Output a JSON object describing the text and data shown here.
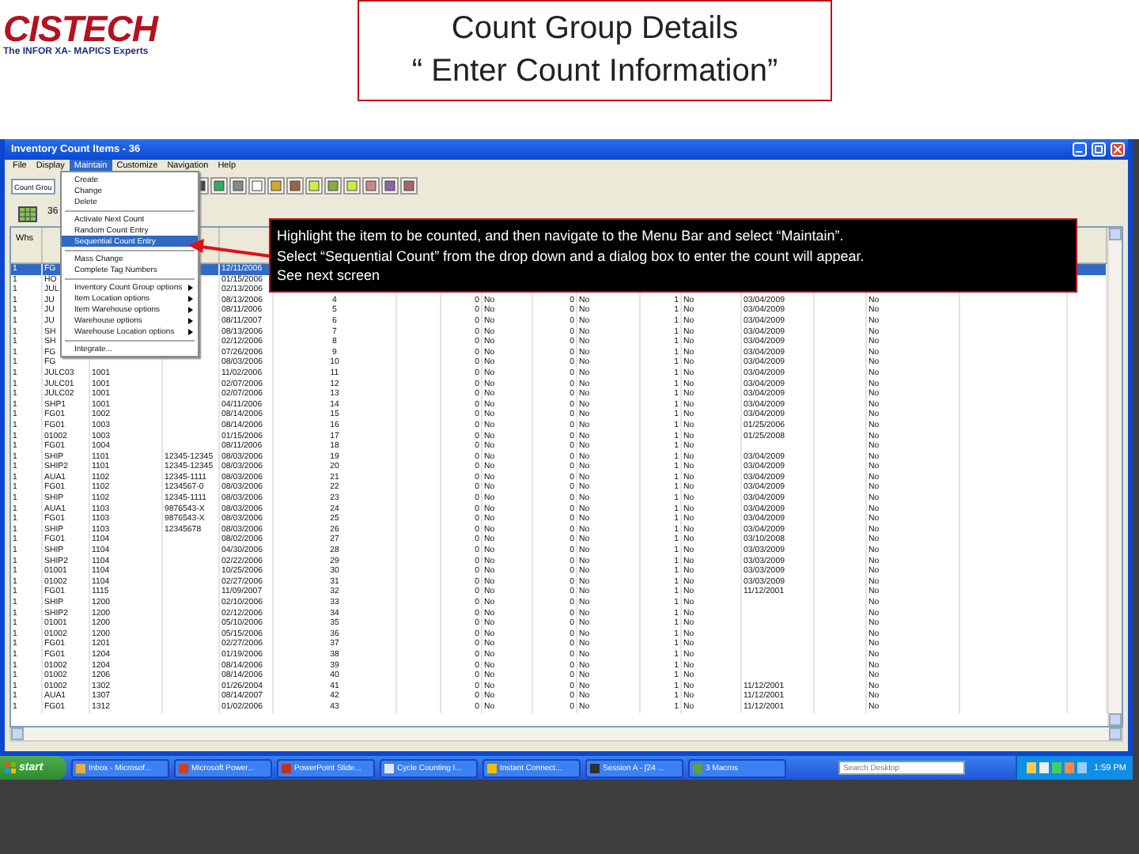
{
  "slide": {
    "logo": "CISTECH",
    "tagline": "The INFOR XA- MAPICS Experts",
    "title": "Count Group Details",
    "subtitle": "“ Enter Count Information”"
  },
  "window": {
    "title": "Inventory Count Items - 36"
  },
  "menubar": [
    {
      "label": "File",
      "selected": false
    },
    {
      "label": "Display",
      "selected": false
    },
    {
      "label": "Maintain",
      "selected": true
    },
    {
      "label": "Customize",
      "selected": false
    },
    {
      "label": "Navigation",
      "selected": false
    },
    {
      "label": "Help",
      "selected": false
    }
  ],
  "toolbar": {
    "dropdown": "Count Grou",
    "count": "36"
  },
  "menu": [
    {
      "kind": "item",
      "label": "Create",
      "selected": false
    },
    {
      "kind": "item",
      "label": "Change",
      "selected": false
    },
    {
      "kind": "item",
      "label": "Delete",
      "selected": false
    },
    {
      "kind": "separator"
    },
    {
      "kind": "item",
      "label": "Activate Next Count",
      "selected": false
    },
    {
      "kind": "item",
      "label": "Random Count Entry",
      "selected": false
    },
    {
      "kind": "item",
      "label": "Sequential Count Entry",
      "selected": true
    },
    {
      "kind": "separator"
    },
    {
      "kind": "item",
      "label": "Mass Change",
      "selected": false
    },
    {
      "kind": "item",
      "label": "Complete Tag Numbers",
      "selected": false
    },
    {
      "kind": "separator"
    },
    {
      "kind": "submenu",
      "label": "Inventory Count Group options",
      "selected": false
    },
    {
      "kind": "submenu",
      "label": "Item Location options",
      "selected": false
    },
    {
      "kind": "submenu",
      "label": "Item Warehouse options",
      "selected": false
    },
    {
      "kind": "submenu",
      "label": "Warehouse options",
      "selected": false
    },
    {
      "kind": "submenu",
      "label": "Warehouse Location options",
      "selected": false
    },
    {
      "kind": "separator"
    },
    {
      "kind": "item",
      "label": "Integrate...",
      "selected": false
    }
  ],
  "callout": {
    "lines": [
      "Highlight the item to be counted, and then navigate to the Menu Bar  and select “Maintain”.",
      "Select “Sequential Count” from the drop down and a dialog box to enter the count will appear.",
      "See next screen"
    ]
  },
  "table": {
    "header": "Whs",
    "rows": [
      {
        "selected": true,
        "cells": [
          "1",
          "FG",
          null,
          null,
          "12/11/2006",
          null,
          null,
          null,
          null,
          null,
          null,
          null,
          null,
          null
        ]
      },
      {
        "selected": false,
        "cells": [
          "1",
          "HO",
          null,
          null,
          "01/15/2006",
          null,
          null,
          null,
          null,
          null,
          null,
          null,
          null,
          null
        ]
      },
      {
        "selected": false,
        "cells": [
          "1",
          "JUL",
          null,
          null,
          "02/13/2006",
          null,
          null,
          null,
          null,
          null,
          null,
          null,
          null,
          null
        ]
      },
      {
        "selected": false,
        "cells": [
          "1",
          "JU",
          null,
          null,
          "08/13/2006",
          "4",
          "0",
          "No",
          "0",
          "No",
          "1",
          "No",
          "03/04/2009",
          "No"
        ]
      },
      {
        "selected": false,
        "cells": [
          "1",
          "JU",
          null,
          null,
          "08/11/2006",
          "5",
          "0",
          "No",
          "0",
          "No",
          "1",
          "No",
          "03/04/2009",
          "No"
        ]
      },
      {
        "selected": false,
        "cells": [
          "1",
          "JU",
          null,
          null,
          "08/11/2007",
          "6",
          "0",
          "No",
          "0",
          "No",
          "1",
          "No",
          "03/04/2009",
          "No"
        ]
      },
      {
        "selected": false,
        "cells": [
          "1",
          "SH",
          null,
          null,
          "08/13/2006",
          "7",
          "0",
          "No",
          "0",
          "No",
          "1",
          "No",
          "03/04/2009",
          "No"
        ]
      },
      {
        "selected": false,
        "cells": [
          "1",
          "SH",
          null,
          null,
          "02/12/2006",
          "8",
          "0",
          "No",
          "0",
          "No",
          "1",
          "No",
          "03/04/2009",
          "No"
        ]
      },
      {
        "selected": false,
        "cells": [
          "1",
          "FG",
          null,
          null,
          "07/26/2006",
          "9",
          "0",
          "No",
          "0",
          "No",
          "1",
          "No",
          "03/04/2009",
          "No"
        ]
      },
      {
        "selected": false,
        "cells": [
          "1",
          "FG",
          null,
          null,
          "08/03/2006",
          "10",
          "0",
          "No",
          "0",
          "No",
          "1",
          "No",
          "03/04/2009",
          "No"
        ]
      },
      {
        "selected": false,
        "cells": [
          "1",
          "JULC03",
          "1001",
          null,
          "11/02/2006",
          "11",
          "0",
          "No",
          "0",
          "No",
          "1",
          "No",
          "03/04/2009",
          "No"
        ]
      },
      {
        "selected": false,
        "cells": [
          "1",
          "JULC01",
          "1001",
          null,
          "02/07/2006",
          "12",
          "0",
          "No",
          "0",
          "No",
          "1",
          "No",
          "03/04/2009",
          "No"
        ]
      },
      {
        "selected": false,
        "cells": [
          "1",
          "JULC02",
          "1001",
          null,
          "02/07/2006",
          "13",
          "0",
          "No",
          "0",
          "No",
          "1",
          "No",
          "03/04/2009",
          "No"
        ]
      },
      {
        "selected": false,
        "cells": [
          "1",
          "SHP1",
          "1001",
          null,
          "04/11/2006",
          "14",
          "0",
          "No",
          "0",
          "No",
          "1",
          "No",
          "03/04/2009",
          "No"
        ]
      },
      {
        "selected": false,
        "cells": [
          "1",
          "FG01",
          "1002",
          null,
          "08/14/2006",
          "15",
          "0",
          "No",
          "0",
          "No",
          "1",
          "No",
          "03/04/2009",
          "No"
        ]
      },
      {
        "selected": false,
        "cells": [
          "1",
          "FG01",
          "1003",
          null,
          "08/14/2006",
          "16",
          "0",
          "No",
          "0",
          "No",
          "1",
          "No",
          "01/25/2006",
          "No"
        ]
      },
      {
        "selected": false,
        "cells": [
          "1",
          "01002",
          "1003",
          null,
          "01/15/2006",
          "17",
          "0",
          "No",
          "0",
          "No",
          "1",
          "No",
          "01/25/2008",
          "No"
        ]
      },
      {
        "selected": false,
        "cells": [
          "1",
          "FG01",
          "1004",
          null,
          "08/11/2006",
          "18",
          "0",
          "No",
          "0",
          "No",
          "1",
          "No",
          null,
          "No"
        ]
      },
      {
        "selected": false,
        "cells": [
          "1",
          "SHIP",
          "1101",
          "12345-12345",
          "08/03/2006",
          "19",
          "0",
          "No",
          "0",
          "No",
          "1",
          "No",
          "03/04/2009",
          "No"
        ]
      },
      {
        "selected": false,
        "cells": [
          "1",
          "SHIP2",
          "1101",
          "12345-12345",
          "08/03/2006",
          "20",
          "0",
          "No",
          "0",
          "No",
          "1",
          "No",
          "03/04/2009",
          "No"
        ]
      },
      {
        "selected": false,
        "cells": [
          "1",
          "AUA1",
          "1102",
          "12345-1111",
          "08/03/2006",
          "21",
          "0",
          "No",
          "0",
          "No",
          "1",
          "No",
          "03/04/2009",
          "No"
        ]
      },
      {
        "selected": false,
        "cells": [
          "1",
          "FG01",
          "1102",
          "1234567-0",
          "08/03/2006",
          "22",
          "0",
          "No",
          "0",
          "No",
          "1",
          "No",
          "03/04/2009",
          "No"
        ]
      },
      {
        "selected": false,
        "cells": [
          "1",
          "SHIP",
          "1102",
          "12345-1111",
          "08/03/2006",
          "23",
          "0",
          "No",
          "0",
          "No",
          "1",
          "No",
          "03/04/2009",
          "No"
        ]
      },
      {
        "selected": false,
        "cells": [
          "1",
          "AUA1",
          "1103",
          "9876543-X",
          "08/03/2006",
          "24",
          "0",
          "No",
          "0",
          "No",
          "1",
          "No",
          "03/04/2009",
          "No"
        ]
      },
      {
        "selected": false,
        "cells": [
          "1",
          "FG01",
          "1103",
          "9876543-X",
          "08/03/2006",
          "25",
          "0",
          "No",
          "0",
          "No",
          "1",
          "No",
          "03/04/2009",
          "No"
        ]
      },
      {
        "selected": false,
        "cells": [
          "1",
          "SHIP",
          "1103",
          "12345678",
          "08/03/2006",
          "26",
          "0",
          "No",
          "0",
          "No",
          "1",
          "No",
          "03/04/2009",
          "No"
        ]
      },
      {
        "selected": false,
        "cells": [
          "1",
          "FG01",
          "1104",
          null,
          "08/02/2006",
          "27",
          "0",
          "No",
          "0",
          "No",
          "1",
          "No",
          "03/10/2008",
          "No"
        ]
      },
      {
        "selected": false,
        "cells": [
          "1",
          "SHIP",
          "1104",
          null,
          "04/30/2006",
          "28",
          "0",
          "No",
          "0",
          "No",
          "1",
          "No",
          "03/03/2009",
          "No"
        ]
      },
      {
        "selected": false,
        "cells": [
          "1",
          "SHIP2",
          "1104",
          null,
          "02/22/2006",
          "29",
          "0",
          "No",
          "0",
          "No",
          "1",
          "No",
          "03/03/2009",
          "No"
        ]
      },
      {
        "selected": false,
        "cells": [
          "1",
          "01001",
          "1104",
          null,
          "10/25/2006",
          "30",
          "0",
          "No",
          "0",
          "No",
          "1",
          "No",
          "03/03/2009",
          "No"
        ]
      },
      {
        "selected": false,
        "cells": [
          "1",
          "01002",
          "1104",
          null,
          "02/27/2006",
          "31",
          "0",
          "No",
          "0",
          "No",
          "1",
          "No",
          "03/03/2009",
          "No"
        ]
      },
      {
        "selected": false,
        "cells": [
          "1",
          "FG01",
          "1115",
          null,
          "11/09/2007",
          "32",
          "0",
          "No",
          "0",
          "No",
          "1",
          "No",
          "11/12/2001",
          "No"
        ]
      },
      {
        "selected": false,
        "cells": [
          "1",
          "SHIP",
          "1200",
          null,
          "02/10/2006",
          "33",
          "0",
          "No",
          "0",
          "No",
          "1",
          "No",
          null,
          "No"
        ]
      },
      {
        "selected": false,
        "cells": [
          "1",
          "SHIP2",
          "1200",
          null,
          "02/12/2006",
          "34",
          "0",
          "No",
          "0",
          "No",
          "1",
          "No",
          null,
          "No"
        ]
      },
      {
        "selected": false,
        "cells": [
          "1",
          "01001",
          "1200",
          null,
          "05/10/2006",
          "35",
          "0",
          "No",
          "0",
          "No",
          "1",
          "No",
          null,
          "No"
        ]
      },
      {
        "selected": false,
        "cells": [
          "1",
          "01002",
          "1200",
          null,
          "05/15/2006",
          "36",
          "0",
          "No",
          "0",
          "No",
          "1",
          "No",
          null,
          "No"
        ]
      },
      {
        "selected": false,
        "cells": [
          "1",
          "FG01",
          "1201",
          null,
          "02/27/2006",
          "37",
          "0",
          "No",
          "0",
          "No",
          "1",
          "No",
          null,
          "No"
        ]
      },
      {
        "selected": false,
        "cells": [
          "1",
          "FG01",
          "1204",
          null,
          "01/19/2006",
          "38",
          "0",
          "No",
          "0",
          "No",
          "1",
          "No",
          null,
          "No"
        ]
      },
      {
        "selected": false,
        "cells": [
          "1",
          "01002",
          "1204",
          null,
          "08/14/2006",
          "39",
          "0",
          "No",
          "0",
          "No",
          "1",
          "No",
          null,
          "No"
        ]
      },
      {
        "selected": false,
        "cells": [
          "1",
          "01002",
          "1206",
          null,
          "08/14/2006",
          "40",
          "0",
          "No",
          "0",
          "No",
          "1",
          "No",
          null,
          "No"
        ]
      },
      {
        "selected": false,
        "cells": [
          "1",
          "01002",
          "1302",
          null,
          "01/26/2004",
          "41",
          "0",
          "No",
          "0",
          "No",
          "1",
          "No",
          "11/12/2001",
          "No"
        ]
      },
      {
        "selected": false,
        "cells": [
          "1",
          "AUA1",
          "1307",
          null,
          "08/14/2007",
          "42",
          "0",
          "No",
          "0",
          "No",
          "1",
          "No",
          "11/12/2001",
          "No"
        ]
      },
      {
        "selected": false,
        "cells": [
          "1",
          "FG01",
          "1312",
          null,
          "01/02/2006",
          "43",
          "0",
          "No",
          "0",
          "No",
          "1",
          "No",
          "11/12/2001",
          "No"
        ]
      }
    ]
  },
  "taskbar": {
    "start": "start",
    "buttons": [
      {
        "label": "Inbox - Microsof...",
        "color": "#e8b040"
      },
      {
        "label": "Microsoft Power...",
        "color": "#d04020"
      },
      {
        "label": "PowerPoint Slide...",
        "color": "#c03020"
      },
      {
        "label": "Cycle Counting I...",
        "color": "#e0e8f8"
      },
      {
        "label": "Instant Connect...",
        "color": "#f0c000"
      },
      {
        "label": "Session A - [24 ...",
        "color": "#303030"
      },
      {
        "label": "3 Macros",
        "color": "#60a040"
      }
    ],
    "search_placeholder": "Search Desktop",
    "clock": "1:59 PM"
  }
}
